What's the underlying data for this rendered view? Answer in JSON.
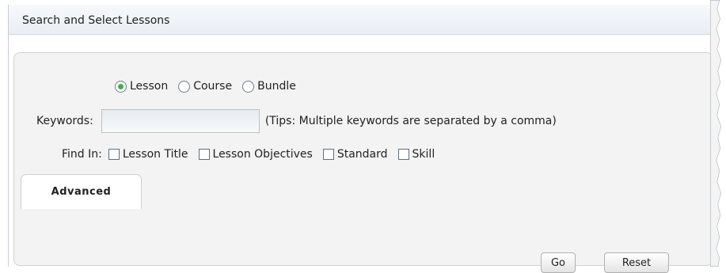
{
  "header": {
    "title": "Search and Select Lessons"
  },
  "search_type": {
    "options": [
      {
        "label": "Lesson",
        "selected": true
      },
      {
        "label": "Course",
        "selected": false
      },
      {
        "label": "Bundle",
        "selected": false
      }
    ]
  },
  "keywords": {
    "label": "Keywords:",
    "value": "",
    "tip": "(Tips: Multiple keywords are separated by a comma)"
  },
  "find_in": {
    "label": "Find In:",
    "options": [
      {
        "label": "Lesson Title",
        "checked": false
      },
      {
        "label": "Lesson Objectives",
        "checked": false
      },
      {
        "label": "Standard",
        "checked": false
      },
      {
        "label": "Skill",
        "checked": false
      }
    ]
  },
  "tabs": {
    "advanced_label": "Advanced"
  },
  "actions": {
    "go_label": "Go",
    "reset_label": "Reset"
  },
  "colors": {
    "radio_selected": "#3fae4e",
    "panel_bg": "#f3f3f3",
    "header_bg": "#e9eef4"
  }
}
